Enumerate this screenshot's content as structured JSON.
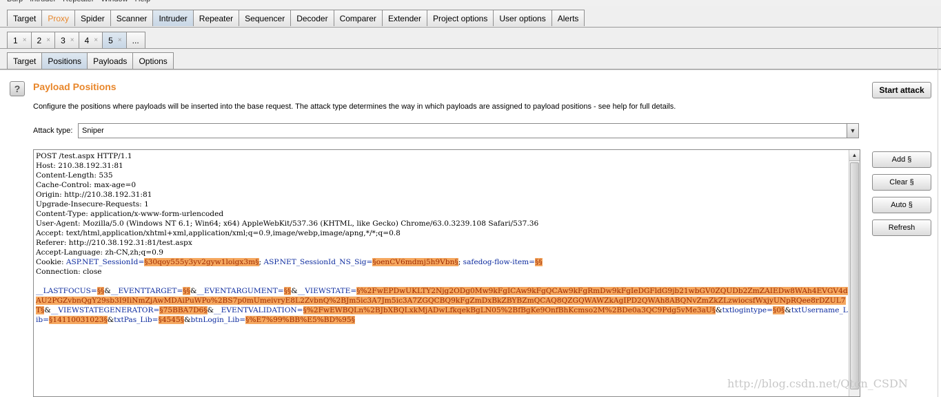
{
  "menubar": {
    "items": [
      "Burp",
      "Intruder",
      "Repeater",
      "Window",
      "Help"
    ]
  },
  "main_tabs": [
    {
      "label": "Target"
    },
    {
      "label": "Proxy"
    },
    {
      "label": "Spider"
    },
    {
      "label": "Scanner"
    },
    {
      "label": "Intruder"
    },
    {
      "label": "Repeater"
    },
    {
      "label": "Sequencer"
    },
    {
      "label": "Decoder"
    },
    {
      "label": "Comparer"
    },
    {
      "label": "Extender"
    },
    {
      "label": "Project options"
    },
    {
      "label": "User options"
    },
    {
      "label": "Alerts"
    }
  ],
  "attack_tabs": [
    {
      "label": "1",
      "close": "×"
    },
    {
      "label": "2",
      "close": "×"
    },
    {
      "label": "3",
      "close": "×"
    },
    {
      "label": "4",
      "close": "×"
    },
    {
      "label": "5",
      "close": "×"
    },
    {
      "label": "..."
    }
  ],
  "sub_tabs": [
    {
      "label": "Target"
    },
    {
      "label": "Positions"
    },
    {
      "label": "Payloads"
    },
    {
      "label": "Options"
    }
  ],
  "panel": {
    "help_symbol": "?",
    "title": "Payload Positions",
    "description": "Configure the positions where payloads will be inserted into the base request. The attack type determines the way in which payloads are assigned to payload positions - see help for full details.",
    "start_attack": "Start attack",
    "attack_type_label": "Attack type:",
    "attack_type_value": "Sniper"
  },
  "request": {
    "lines": [
      "POST /test.aspx HTTP/1.1",
      "Host: 210.38.192.31:81",
      "Content-Length: 535",
      "Cache-Control: max-age=0",
      "Origin: http://210.38.192.31:81",
      "Upgrade-Insecure-Requests: 1",
      "Content-Type: application/x-www-form-urlencoded",
      "User-Agent: Mozilla/5.0 (Windows NT 6.1; Win64; x64) AppleWebKit/537.36 (KHTML, like Gecko) Chrome/63.0.3239.108 Safari/537.36",
      "Accept: text/html,application/xhtml+xml,application/xml;q=0.9,image/webp,image/apng,*/*;q=0.8",
      "Referer: http://210.38.192.31:81/test.aspx",
      "Accept-Language: zh-CN,zh;q=0.9"
    ],
    "cookie": [
      {
        "t": "t",
        "v": "Cookie: "
      },
      {
        "t": "n",
        "v": "ASP.NET_SessionId="
      },
      {
        "t": "m",
        "v": "§30qoy555y3yv2gyw1loigx3m§"
      },
      {
        "t": "t",
        "v": "; "
      },
      {
        "t": "n",
        "v": "ASP.NET_SessionId_NS_Sig="
      },
      {
        "t": "m",
        "v": "§oenCV6mdmj5h9Vbn§"
      },
      {
        "t": "t",
        "v": "; "
      },
      {
        "t": "n",
        "v": "safedog-flow-item="
      },
      {
        "t": "m",
        "v": "§§"
      }
    ],
    "connection": "Connection: close",
    "body": [
      {
        "t": "n",
        "v": "__LASTFOCUS="
      },
      {
        "t": "m",
        "v": "§§"
      },
      {
        "t": "t",
        "v": "&"
      },
      {
        "t": "n",
        "v": "__EVENTTARGET="
      },
      {
        "t": "m",
        "v": "§§"
      },
      {
        "t": "t",
        "v": "&"
      },
      {
        "t": "n",
        "v": "__EVENTARGUMENT="
      },
      {
        "t": "m",
        "v": "§§"
      },
      {
        "t": "t",
        "v": "&"
      },
      {
        "t": "n",
        "v": "__VIEWSTATE="
      },
      {
        "t": "m",
        "v": "§%2FwEPDwUKLTY2Njg2ODg0Mw9kFgICAw9kFgQCAw9kFgRmDw9kFgIeDGFldG9jb21wbGV0ZQUDb2ZmZAIEDw8WAh4EVGV4dAU2PGZvbnQgY29sb3I9IiNmZjAwMDAiPuWPo%2BS7p0mUmeivryE8L2ZvbnQ%2BJm5ic3A7Jm5ic3A7ZGQCBQ9kFgZmDxBkZBYBZmQCAQ8QZGQWAWZkAgIPD2QWAh8ABQNvZmZkZLzwiocsfWxjyUNpRQee8rDZUL7T§"
      },
      {
        "t": "t",
        "v": "&"
      },
      {
        "t": "n",
        "v": "__VIEWSTATEGENERATOR="
      },
      {
        "t": "m",
        "v": "§75BBA7D6§"
      },
      {
        "t": "t",
        "v": "&"
      },
      {
        "t": "n",
        "v": "__EVENTVALIDATION="
      },
      {
        "t": "m",
        "v": "§%2FwEWBQLn%2BJbXBQLxkMjADwLfkqekBgLN05%2BfBgKe9OnfBhKcmso2M%2BDe0a3QC9Pdg5vMe3aU§"
      },
      {
        "t": "t",
        "v": "&"
      },
      {
        "t": "n",
        "v": "txtlogintype="
      },
      {
        "t": "m",
        "v": "§0§"
      },
      {
        "t": "t",
        "v": "&"
      },
      {
        "t": "n",
        "v": "txtUsername_Lib="
      },
      {
        "t": "m",
        "v": "§14110031023§"
      },
      {
        "t": "t",
        "v": "&"
      },
      {
        "t": "n",
        "v": "txtPas_Lib="
      },
      {
        "t": "m",
        "v": "§4545§"
      },
      {
        "t": "t",
        "v": "&"
      },
      {
        "t": "n",
        "v": "btnLogin_Lib="
      },
      {
        "t": "m",
        "v": "§%E7%99%BB%E5%BD%95§"
      }
    ]
  },
  "side_buttons": {
    "add": "Add §",
    "clear": "Clear §",
    "auto": "Auto §",
    "refresh": "Refresh"
  },
  "watermark": "http://blog.csdn.net/Qton_CSDN",
  "colors": {
    "accent": "#e8862a",
    "marker_bg": "#f5a860",
    "param_name": "#0b2a9e"
  }
}
